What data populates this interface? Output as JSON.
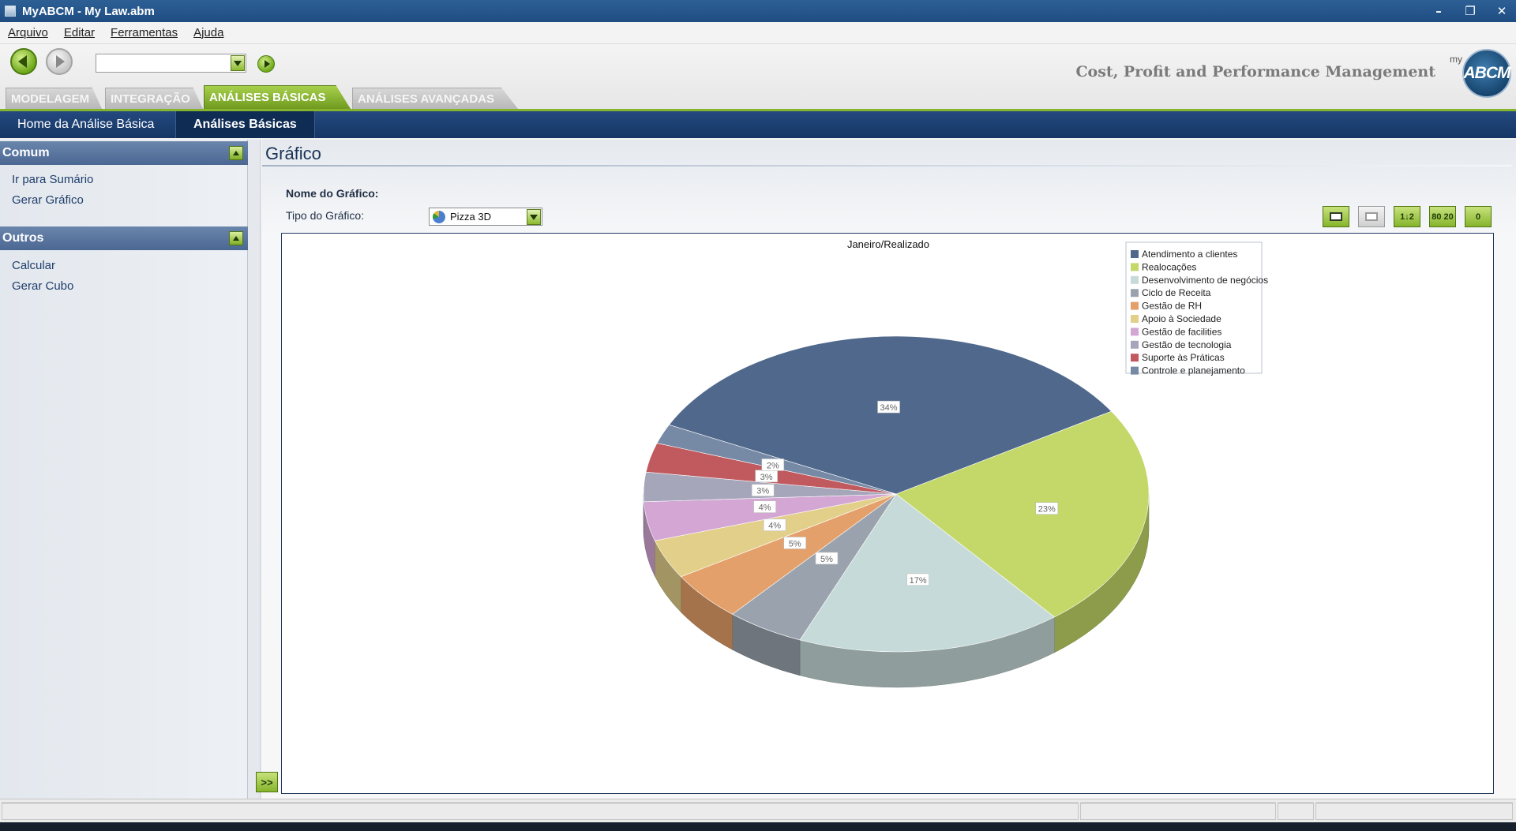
{
  "window": {
    "title": "MyABCM  - My Law.abm",
    "minimize": "–",
    "restore": "❐",
    "close": "✕"
  },
  "menu": [
    "Arquivo",
    "Editar",
    "Ferramentas",
    "Ajuda"
  ],
  "toolbar": {
    "nav_combo_value": "",
    "brand_text": "Cost, Profit and Performance Management",
    "logo_prefix": "my",
    "logo_text": "ABCM"
  },
  "tabs": [
    {
      "label": "MODELAGEM",
      "active": false
    },
    {
      "label": "INTEGRAÇÃO",
      "active": false
    },
    {
      "label": "ANÁLISES BÁSICAS",
      "active": true
    },
    {
      "label": "ANÁLISES AVANÇADAS",
      "active": false
    }
  ],
  "subnav": [
    {
      "label": "Home da Análise Básica",
      "active": false
    },
    {
      "label": "Análises Básicas",
      "active": true
    }
  ],
  "sidebar": {
    "comum": {
      "title": "Comum",
      "links": [
        "Ir para Sumário",
        "Gerar Gráfico"
      ]
    },
    "outros": {
      "title": "Outros",
      "links": [
        "Calcular",
        "Gerar Cubo"
      ]
    },
    "expand_label": ">>"
  },
  "main": {
    "title": "Gráfico",
    "chart_name_label": "Nome do Gráfico:",
    "chart_type_label": "Tipo do Gráfico:",
    "chart_type_value": "Pizza 3D",
    "buttons": [
      {
        "name": "view-chart-button",
        "style": "green"
      },
      {
        "name": "view-table-button",
        "style": "grey"
      },
      {
        "name": "sort-button",
        "label": "1↓2"
      },
      {
        "name": "pareto-80-20-button",
        "label": "80 20"
      },
      {
        "name": "zero-button",
        "label": "0"
      }
    ]
  },
  "chart_data": {
    "type": "pie",
    "title": "Janeiro/Realizado",
    "legend_position": "top-right",
    "slices": [
      {
        "label": "Atendimento a clientes",
        "value": 34,
        "display": "34%",
        "color": "#50688c"
      },
      {
        "label": "Realocações",
        "value": 23,
        "display": "23%",
        "color": "#c3d868"
      },
      {
        "label": "Desenvolvimento de negócios",
        "value": 17,
        "display": "17%",
        "color": "#c6dbd9"
      },
      {
        "label": "Ciclo de Receita",
        "value": 5,
        "display": "5%",
        "color": "#9aa3ad"
      },
      {
        "label": "Gestão de RH",
        "value": 5,
        "display": "5%",
        "color": "#e4a06a"
      },
      {
        "label": "Apoio à Sociedade",
        "value": 4,
        "display": "4%",
        "color": "#e2cf8a"
      },
      {
        "label": "Gestão de facilities",
        "value": 4,
        "display": "4%",
        "color": "#d4a6d4"
      },
      {
        "label": "Gestão de tecnologia",
        "value": 3,
        "display": "3%",
        "color": "#a6a6bb"
      },
      {
        "label": "Suporte às Práticas",
        "value": 3,
        "display": "3%",
        "color": "#c15a5e"
      },
      {
        "label": "Controle e planejamento",
        "value": 2,
        "display": "2%",
        "color": "#768aa6"
      }
    ]
  }
}
